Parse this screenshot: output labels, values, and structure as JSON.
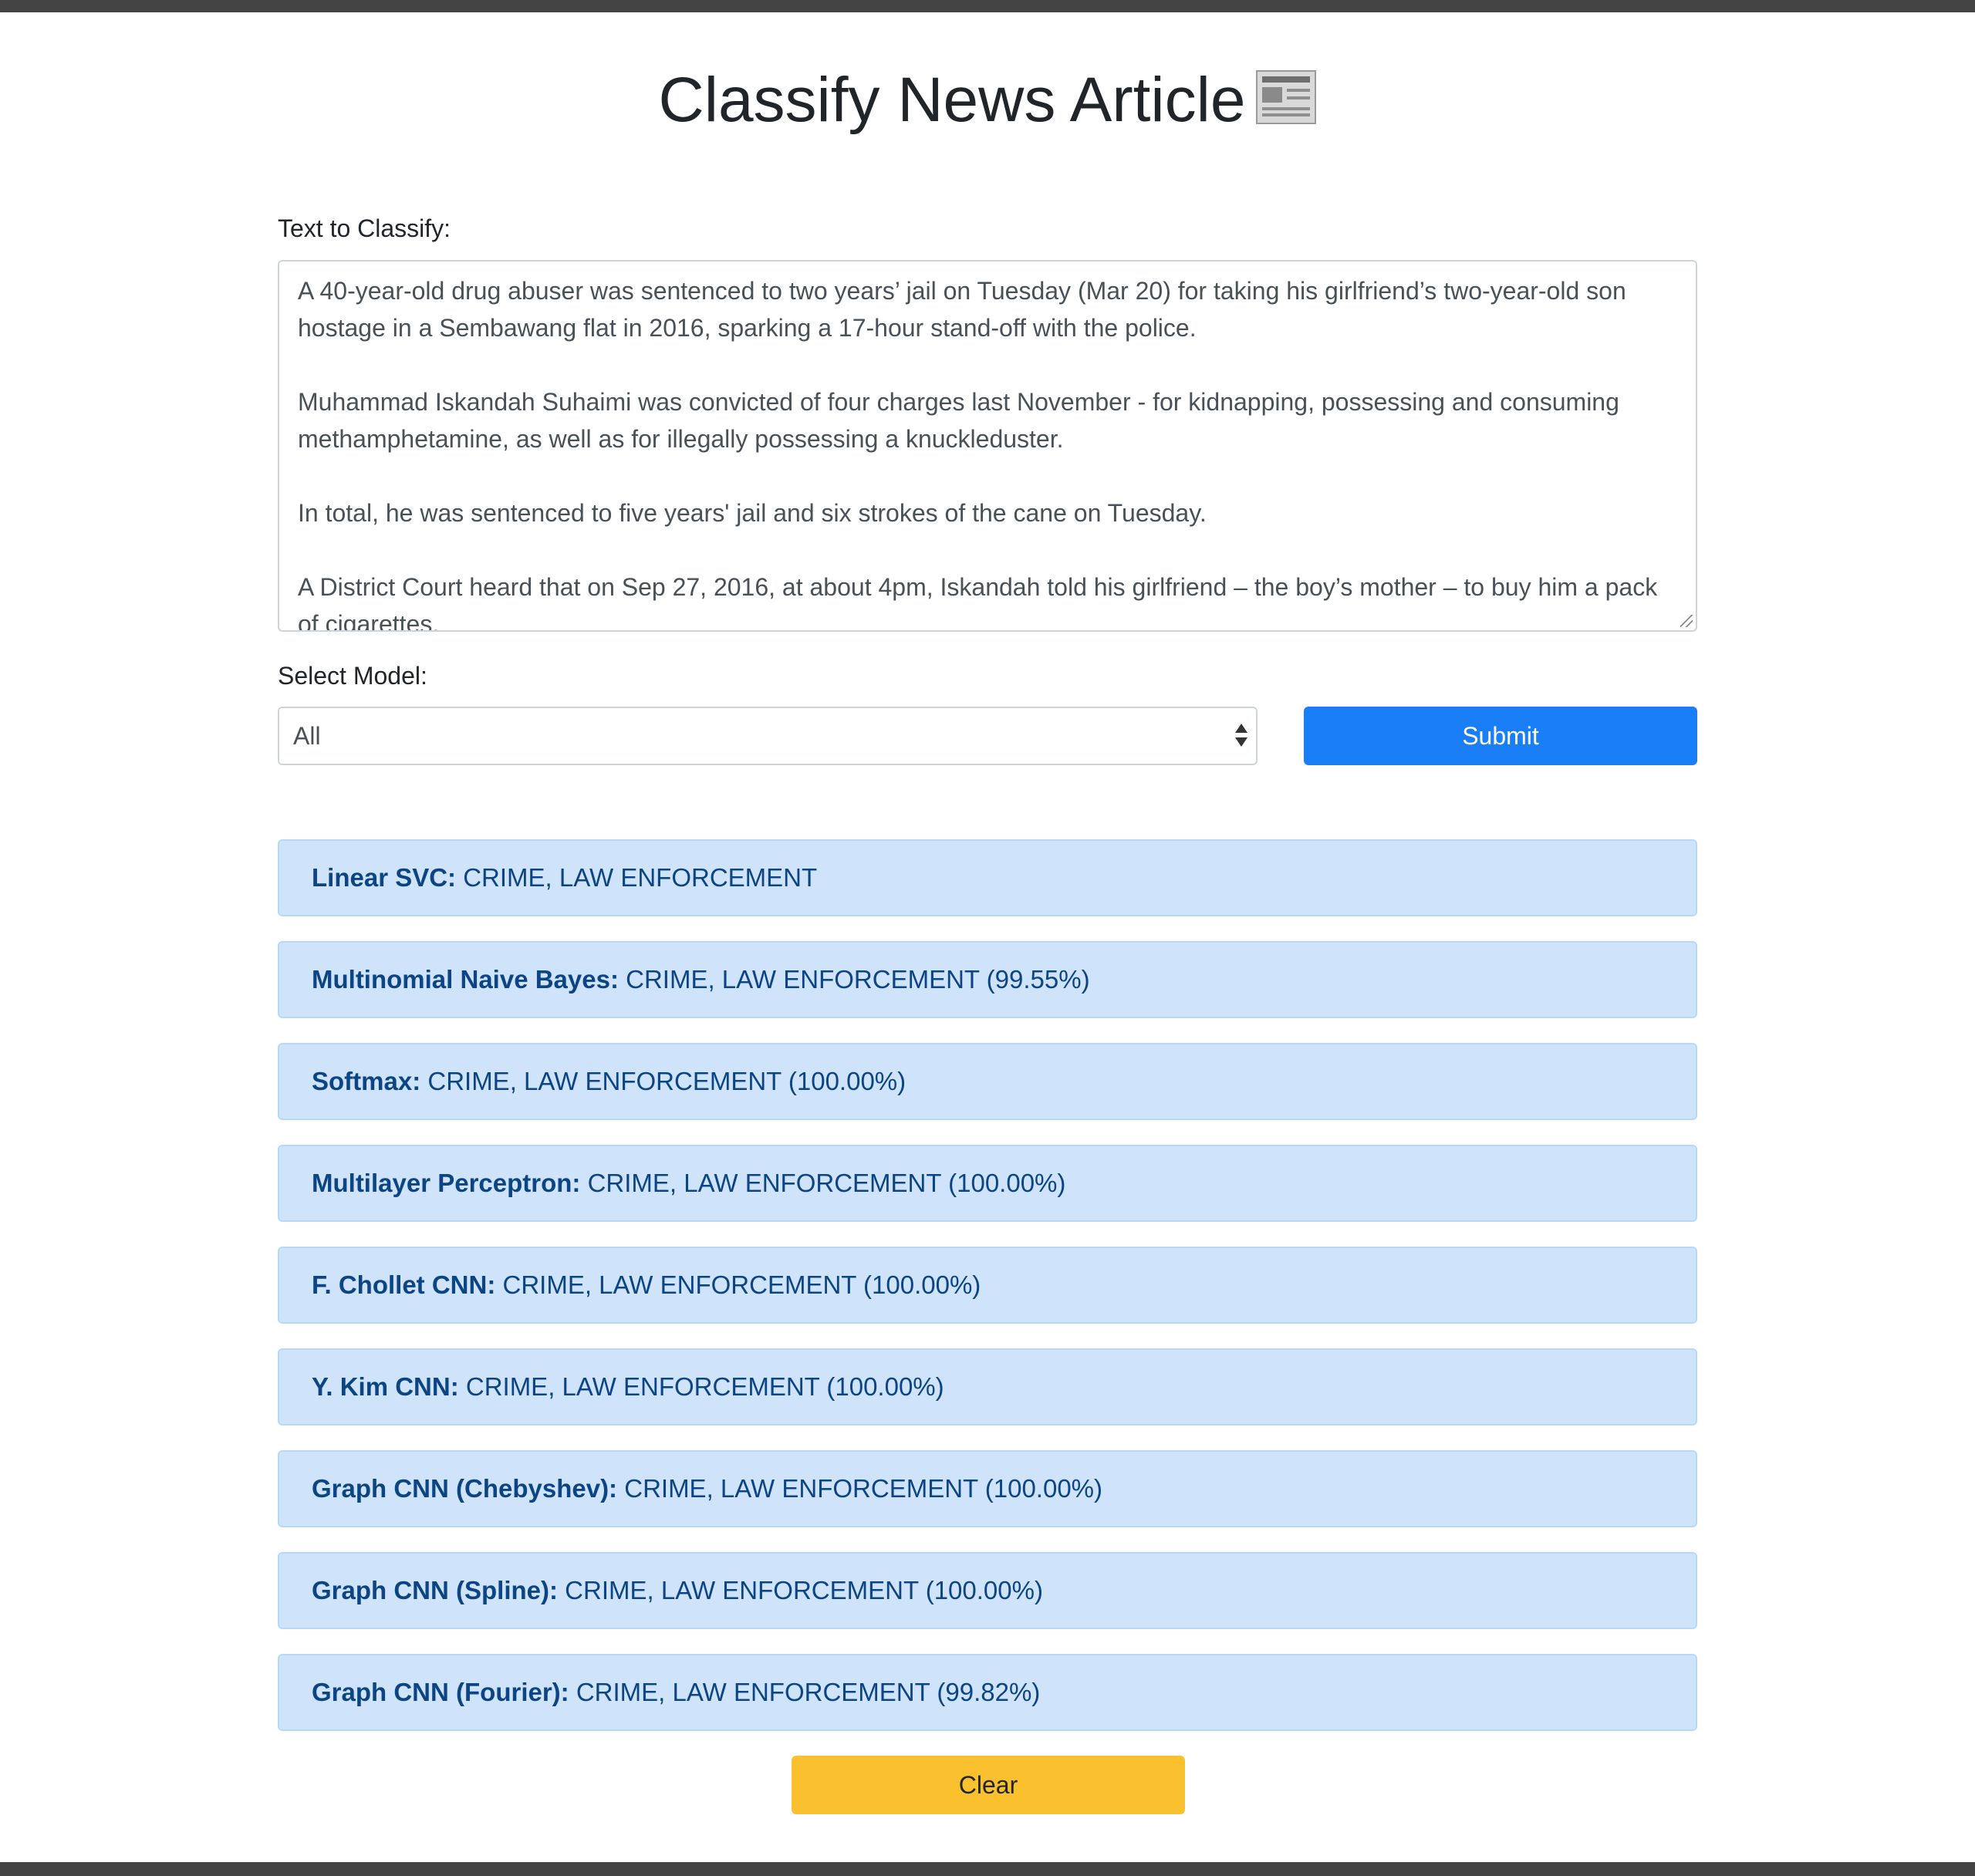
{
  "header": {
    "title": "Classify News Article",
    "title_icon": "newspaper-icon"
  },
  "form": {
    "text_label": "Text to Classify:",
    "text_paragraphs": [
      "A 40-year-old drug abuser was sentenced to two years’ jail on Tuesday (Mar 20) for taking his girlfriend’s two-year-old son hostage in a Sembawang flat in 2016, sparking a 17-hour stand-off with the police.",
      "Muhammad Iskandah Suhaimi was convicted of four charges last November - for kidnapping, possessing and consuming methamphetamine, as well as for illegally possessing a knuckleduster.",
      "In total, he was sentenced to five years' jail and six strokes of the cane on Tuesday.",
      "A District Court heard that on Sep 27, 2016, at about 4pm, Iskandah told his girlfriend – the boy’s mother – to buy him a pack of cigarettes."
    ],
    "model_label": "Select Model:",
    "model_selected": "All",
    "submit_label": "Submit"
  },
  "results": [
    {
      "model": "Linear SVC:",
      "prediction": "CRIME, LAW ENFORCEMENT"
    },
    {
      "model": "Multinomial Naive Bayes:",
      "prediction": "CRIME, LAW ENFORCEMENT (99.55%)"
    },
    {
      "model": "Softmax:",
      "prediction": "CRIME, LAW ENFORCEMENT (100.00%)"
    },
    {
      "model": "Multilayer Perceptron:",
      "prediction": "CRIME, LAW ENFORCEMENT (100.00%)"
    },
    {
      "model": "F. Chollet CNN:",
      "prediction": "CRIME, LAW ENFORCEMENT (100.00%)"
    },
    {
      "model": "Y. Kim CNN:",
      "prediction": "CRIME, LAW ENFORCEMENT (100.00%)"
    },
    {
      "model": "Graph CNN (Chebyshev):",
      "prediction": "CRIME, LAW ENFORCEMENT (100.00%)"
    },
    {
      "model": "Graph CNN (Spline):",
      "prediction": "CRIME, LAW ENFORCEMENT (100.00%)"
    },
    {
      "model": "Graph CNN (Fourier):",
      "prediction": "CRIME, LAW ENFORCEMENT (99.82%)"
    }
  ],
  "actions": {
    "clear_label": "Clear"
  },
  "colors": {
    "submit": "#1a7ef7",
    "result_bg": "#cfe4fb",
    "result_text": "#0c4484",
    "clear": "#fbc02d",
    "bars": "#444444"
  }
}
